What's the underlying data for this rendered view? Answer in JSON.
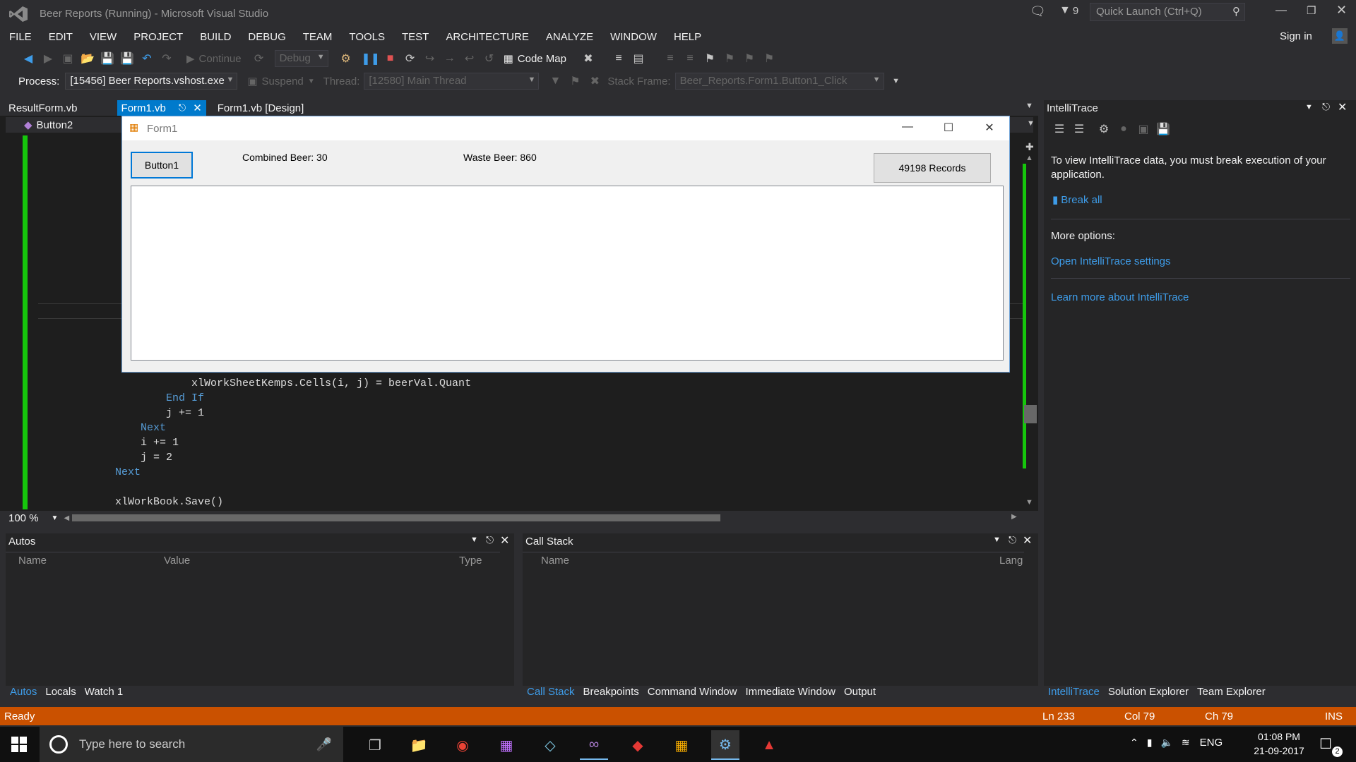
{
  "window": {
    "title": "Beer Reports (Running) - Microsoft Visual Studio",
    "notifications_count": "9",
    "quick_launch_placeholder": "Quick Launch (Ctrl+Q)",
    "sign_in": "Sign in"
  },
  "menu": [
    "FILE",
    "EDIT",
    "VIEW",
    "PROJECT",
    "BUILD",
    "DEBUG",
    "TEAM",
    "TOOLS",
    "TEST",
    "ARCHITECTURE",
    "ANALYZE",
    "WINDOW",
    "HELP"
  ],
  "toolbar": {
    "continue_label": "Continue",
    "config": "Debug",
    "code_map": "Code Map"
  },
  "debug_location": {
    "process_label": "Process:",
    "process_value": "[15456] Beer Reports.vshost.exe",
    "suspend_label": "Suspend",
    "thread_label": "Thread:",
    "thread_value": "[12580] Main Thread",
    "stack_frame_label": "Stack Frame:",
    "stack_frame_value": "Beer_Reports.Form1.Button1_Click"
  },
  "tabs": [
    {
      "label": "ResultForm.vb",
      "active": false
    },
    {
      "label": "Form1.vb",
      "active": true
    },
    {
      "label": "Form1.vb [Design]",
      "active": false
    }
  ],
  "editor": {
    "nav_member": "Button2",
    "zoom": "100 %",
    "code_lines": [
      "xlWorkSheetKemps.Cells(i, j) = beerVal.Quant",
      "End If",
      "j += 1",
      "Next",
      "i += 1",
      "j = 2",
      "Next",
      "",
      "xlWorkBook.Save()"
    ]
  },
  "form1": {
    "title": "Form1",
    "button1": "Button1",
    "combined_beer": "Combined Beer: 30",
    "waste_beer": "Waste Beer: 860",
    "records_button": "49198 Records"
  },
  "autos": {
    "title": "Autos",
    "columns": [
      "Name",
      "Value",
      "Type"
    ],
    "tabs": [
      "Autos",
      "Locals",
      "Watch 1"
    ]
  },
  "callstack": {
    "title": "Call Stack",
    "columns": [
      "Name",
      "Lang"
    ],
    "tabs": [
      "Call Stack",
      "Breakpoints",
      "Command Window",
      "Immediate Window",
      "Output"
    ]
  },
  "intellitrace": {
    "title": "IntelliTrace",
    "message": "To view IntelliTrace data, you must break execution of your application.",
    "break_all": "Break all",
    "more_options": "More options:",
    "open_settings": "Open IntelliTrace settings",
    "learn_more": "Learn more about IntelliTrace",
    "tabs": [
      "IntelliTrace",
      "Solution Explorer",
      "Team Explorer"
    ]
  },
  "statusbar": {
    "status": "Ready",
    "line": "Ln 233",
    "col": "Col 79",
    "ch": "Ch 79",
    "mode": "INS"
  },
  "taskbar": {
    "search_placeholder": "Type here to search",
    "language": "ENG",
    "time": "01:08 PM",
    "date": "21-09-2017",
    "notification_count": "2"
  },
  "colors": {
    "accent": "#007acc",
    "statusbar": "#ca5100",
    "link": "#3e9ce8",
    "green_margin": "#16c60c"
  }
}
